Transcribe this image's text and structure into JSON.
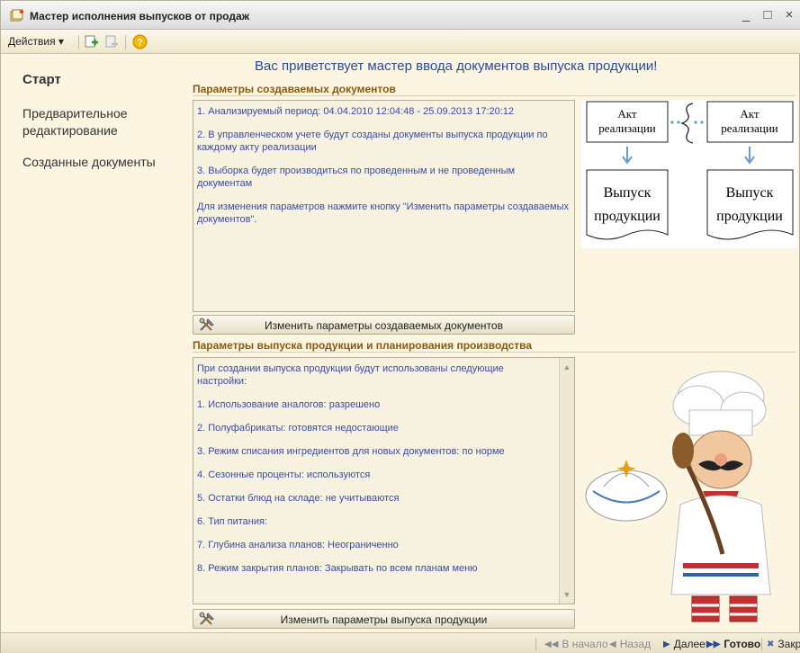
{
  "window": {
    "title": "Мастер исполнения выпусков от продаж",
    "controls": {
      "minimize": "_",
      "maximize": "□",
      "close": "×"
    }
  },
  "toolbar": {
    "actions_label": "Действия ▾",
    "icons": [
      "add-icon",
      "delete-icon",
      "help-icon"
    ]
  },
  "nav": {
    "items": [
      {
        "label": "Старт",
        "active": true
      },
      {
        "label": "Предварительное редактирование",
        "active": false
      },
      {
        "label": "Созданные документы",
        "active": false
      }
    ]
  },
  "main": {
    "title": "Вас приветствует мастер ввода документов выпуска продукции!",
    "section1": {
      "title": "Параметры создаваемых документов",
      "paragraphs": [
        "1. Анализируемый период: 04.04.2010 12:04:48 - 25.09.2013 17:20:12",
        "2. В управленческом учете будут созданы документы выпуска продукции по каждому акту реализации",
        "3. Выборка будет производиться по проведенным и не проведенным документам",
        "Для изменения параметров нажмите кнопку \"Изменить параметры создаваемых документов\"."
      ],
      "button": "Изменить параметры создаваемых документов"
    },
    "section2": {
      "title": "Параметры выпуска продукции и планирования производства",
      "paragraphs": [
        "При создании выпуска продукции будут использованы следующие настройки:",
        "1. Использование аналогов: разрешено",
        "2. Полуфабрикаты: готовятся недостающие",
        "3. Режим списания ингредиентов для новых документов: по норме",
        "4. Сезонные проценты:  используются",
        "5. Остатки блюд на складе: не учитываются",
        "6. Тип питания:",
        "7. Глубина анализа планов: Неограниченно",
        "8. Режим закрытия планов: Закрывать по всем планам меню"
      ],
      "button": "Изменить параметры выпуска продукции"
    },
    "diagram": {
      "act_label_line1": "Акт",
      "act_label_line2": "реализации",
      "output_line1": "Выпуск",
      "output_line2": "продукции"
    }
  },
  "statusbar": {
    "first": "В начало",
    "back": "Назад",
    "next": "Далее",
    "done": "Готово",
    "close": "Закрыть"
  }
}
